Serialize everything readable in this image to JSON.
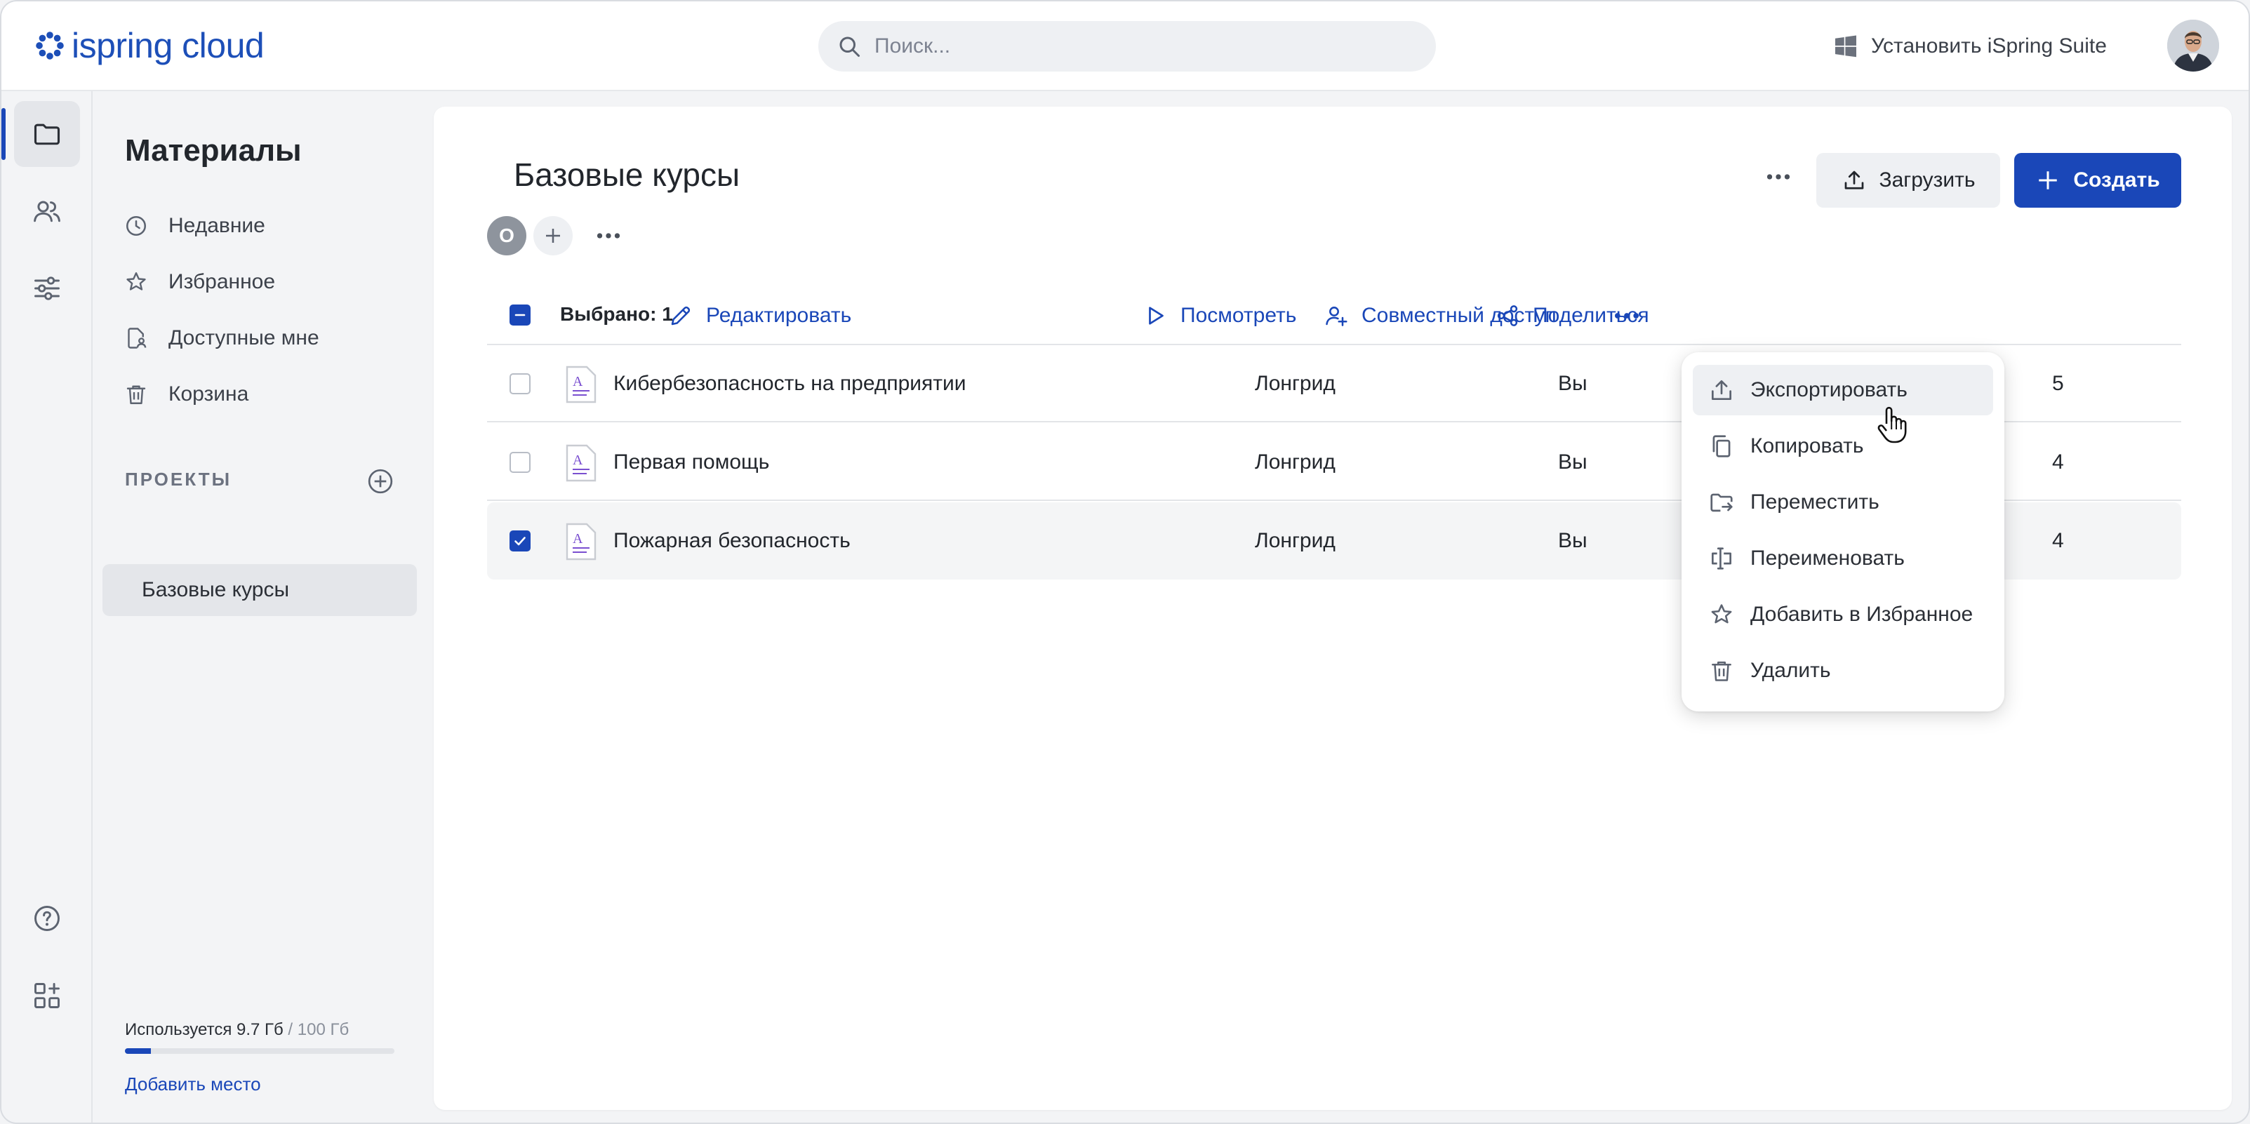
{
  "header": {
    "logo_text": "ispring cloud",
    "search_placeholder": "Поиск...",
    "install_label": "Установить iSpring Suite"
  },
  "sidebar": {
    "title": "Материалы",
    "items": [
      {
        "label": "Недавние",
        "icon": "clock-icon"
      },
      {
        "label": "Избранное",
        "icon": "star-icon"
      },
      {
        "label": "Доступные мне",
        "icon": "shared-file-icon"
      },
      {
        "label": "Корзина",
        "icon": "trash-icon"
      }
    ],
    "projects_heading": "ПРОЕКТЫ",
    "active_project": "Базовые курсы",
    "storage": {
      "used": "Используется 9.7 Гб",
      "total": "/ 100 Гб",
      "fraction": 0.097
    },
    "add_space": "Добавить место"
  },
  "main": {
    "title": "Базовые курсы",
    "member_initial": "О",
    "upload_label": "Загрузить",
    "create_label": "Создать",
    "actionbar": {
      "selected": "Выбрано: 1",
      "edit": "Редактировать",
      "view": "Посмотреть",
      "share_access": "Совместный доступ",
      "share": "Поделиться"
    },
    "rows": [
      {
        "name": "Кибербезопасность на предприятии",
        "type": "Лонгрид",
        "owner": "Вы",
        "date_fragment": "5",
        "checked": false
      },
      {
        "name": "Первая помощь",
        "type": "Лонгрид",
        "owner": "Вы",
        "date_fragment": "4",
        "checked": false
      },
      {
        "name": "Пожарная безопасность",
        "type": "Лонгрид",
        "owner": "Вы",
        "date_fragment": "4",
        "checked": true
      }
    ]
  },
  "menu": {
    "items": [
      {
        "label": "Экспортировать",
        "icon": "export-icon"
      },
      {
        "label": "Копировать",
        "icon": "copy-icon"
      },
      {
        "label": "Переместить",
        "icon": "move-folder-icon"
      },
      {
        "label": "Переименовать",
        "icon": "rename-icon"
      },
      {
        "label": "Добавить в Избранное",
        "icon": "star-icon"
      },
      {
        "label": "Удалить",
        "icon": "trash-icon"
      }
    ]
  },
  "colors": {
    "accent": "#1a47b8",
    "logo": "#1d4fb8",
    "file_icon": "#7a4fd0"
  }
}
